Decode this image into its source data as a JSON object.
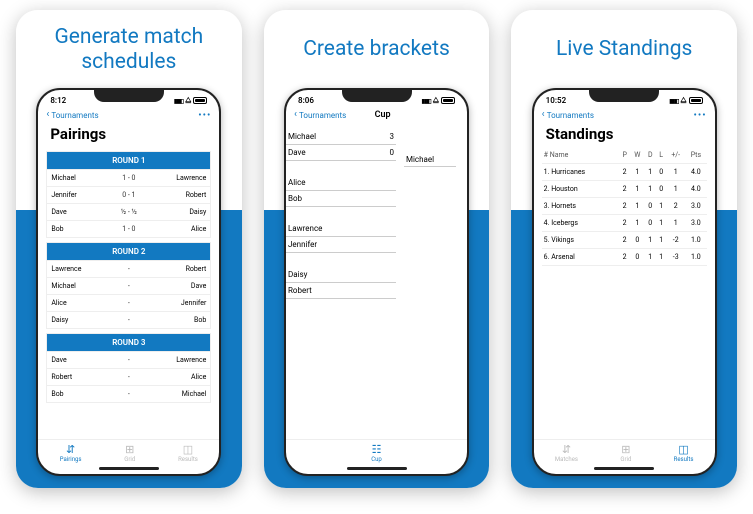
{
  "captions": [
    "Generate match schedules",
    "Create brackets",
    "Live Standings"
  ],
  "back_label": "Tournaments",
  "more_icon": "•••",
  "phone1": {
    "time": "8:12",
    "title": "Pairings",
    "rounds": [
      {
        "name": "ROUND 1",
        "matches": [
          {
            "l": "Michael",
            "s": "1 - 0",
            "r": "Lawrence"
          },
          {
            "l": "Jennifer",
            "s": "0 - 1",
            "r": "Robert"
          },
          {
            "l": "Dave",
            "s": "½ - ½",
            "r": "Daisy"
          },
          {
            "l": "Bob",
            "s": "1 - 0",
            "r": "Alice"
          }
        ]
      },
      {
        "name": "ROUND 2",
        "matches": [
          {
            "l": "Lawrence",
            "s": "-",
            "r": "Robert"
          },
          {
            "l": "Michael",
            "s": "-",
            "r": "Dave"
          },
          {
            "l": "Alice",
            "s": "-",
            "r": "Jennifer"
          },
          {
            "l": "Daisy",
            "s": "-",
            "r": "Bob"
          }
        ]
      },
      {
        "name": "ROUND 3",
        "matches": [
          {
            "l": "Dave",
            "s": "-",
            "r": "Lawrence"
          },
          {
            "l": "Robert",
            "s": "-",
            "r": "Alice"
          },
          {
            "l": "Bob",
            "s": "-",
            "r": "Michael"
          }
        ]
      }
    ],
    "tabs": [
      {
        "icon": "⇵",
        "label": "Pairings",
        "active": true
      },
      {
        "icon": "⊞",
        "label": "Grid",
        "active": false
      },
      {
        "icon": "◫",
        "label": "Results",
        "active": false
      }
    ]
  },
  "phone2": {
    "time": "8:06",
    "navtitle": "Cup",
    "bracket": [
      [
        {
          "n": "Michael",
          "s": "3"
        },
        {
          "n": "Dave",
          "s": "0"
        }
      ],
      [
        {
          "n": "Alice",
          "s": ""
        },
        {
          "n": "Bob",
          "s": ""
        }
      ],
      [
        {
          "n": "Lawrence",
          "s": ""
        },
        {
          "n": "Jennifer",
          "s": ""
        }
      ],
      [
        {
          "n": "Daisy",
          "s": ""
        },
        {
          "n": "Robert",
          "s": ""
        }
      ]
    ],
    "winner": "Michael",
    "tabs": [
      {
        "icon": "☷",
        "label": "Cup",
        "active": true
      }
    ]
  },
  "phone3": {
    "time": "10:52",
    "title": "Standings",
    "headers": [
      "# Name",
      "P",
      "W",
      "D",
      "L",
      "+/-",
      "Pts"
    ],
    "rows": [
      [
        "1. Hurricanes",
        "2",
        "1",
        "1",
        "0",
        "1",
        "4.0"
      ],
      [
        "2. Houston",
        "2",
        "1",
        "1",
        "0",
        "1",
        "4.0"
      ],
      [
        "3. Hornets",
        "2",
        "1",
        "0",
        "1",
        "2",
        "3.0"
      ],
      [
        "4. Icebergs",
        "2",
        "1",
        "0",
        "1",
        "1",
        "3.0"
      ],
      [
        "5. Vikings",
        "2",
        "0",
        "1",
        "1",
        "-2",
        "1.0"
      ],
      [
        "6. Arsenal",
        "2",
        "0",
        "1",
        "1",
        "-3",
        "1.0"
      ]
    ],
    "tabs": [
      {
        "icon": "⇵",
        "label": "Matches",
        "active": false
      },
      {
        "icon": "⊞",
        "label": "Grid",
        "active": false
      },
      {
        "icon": "◫",
        "label": "Results",
        "active": true
      }
    ]
  }
}
